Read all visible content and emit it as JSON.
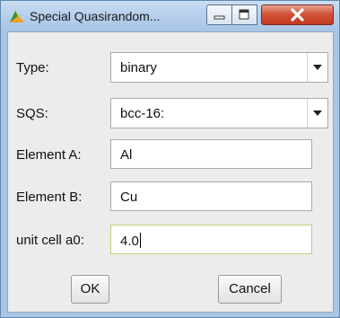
{
  "window": {
    "title": "Special Quasirandom..."
  },
  "form": {
    "type": {
      "label": "Type:",
      "value": "binary"
    },
    "sqs": {
      "label": "SQS:",
      "value": "bcc-16:"
    },
    "element_a": {
      "label": "Element A:",
      "value": "Al"
    },
    "element_b": {
      "label": "Element B:",
      "value": "Cu"
    },
    "unit_cell": {
      "label": "unit cell a0:",
      "value": "4.0"
    }
  },
  "buttons": {
    "ok": "OK",
    "cancel": "Cancel"
  },
  "colors": {
    "titlebar": "#b7d0ec",
    "close_button": "#c23b22",
    "dialog_bg": "#ececec",
    "active_border": "#b8d37a"
  },
  "icons": {
    "app": "triangle-app-icon",
    "minimize": "minimize-icon",
    "maximize": "maximize-icon",
    "close": "close-icon",
    "dropdown": "chevron-down-icon"
  }
}
